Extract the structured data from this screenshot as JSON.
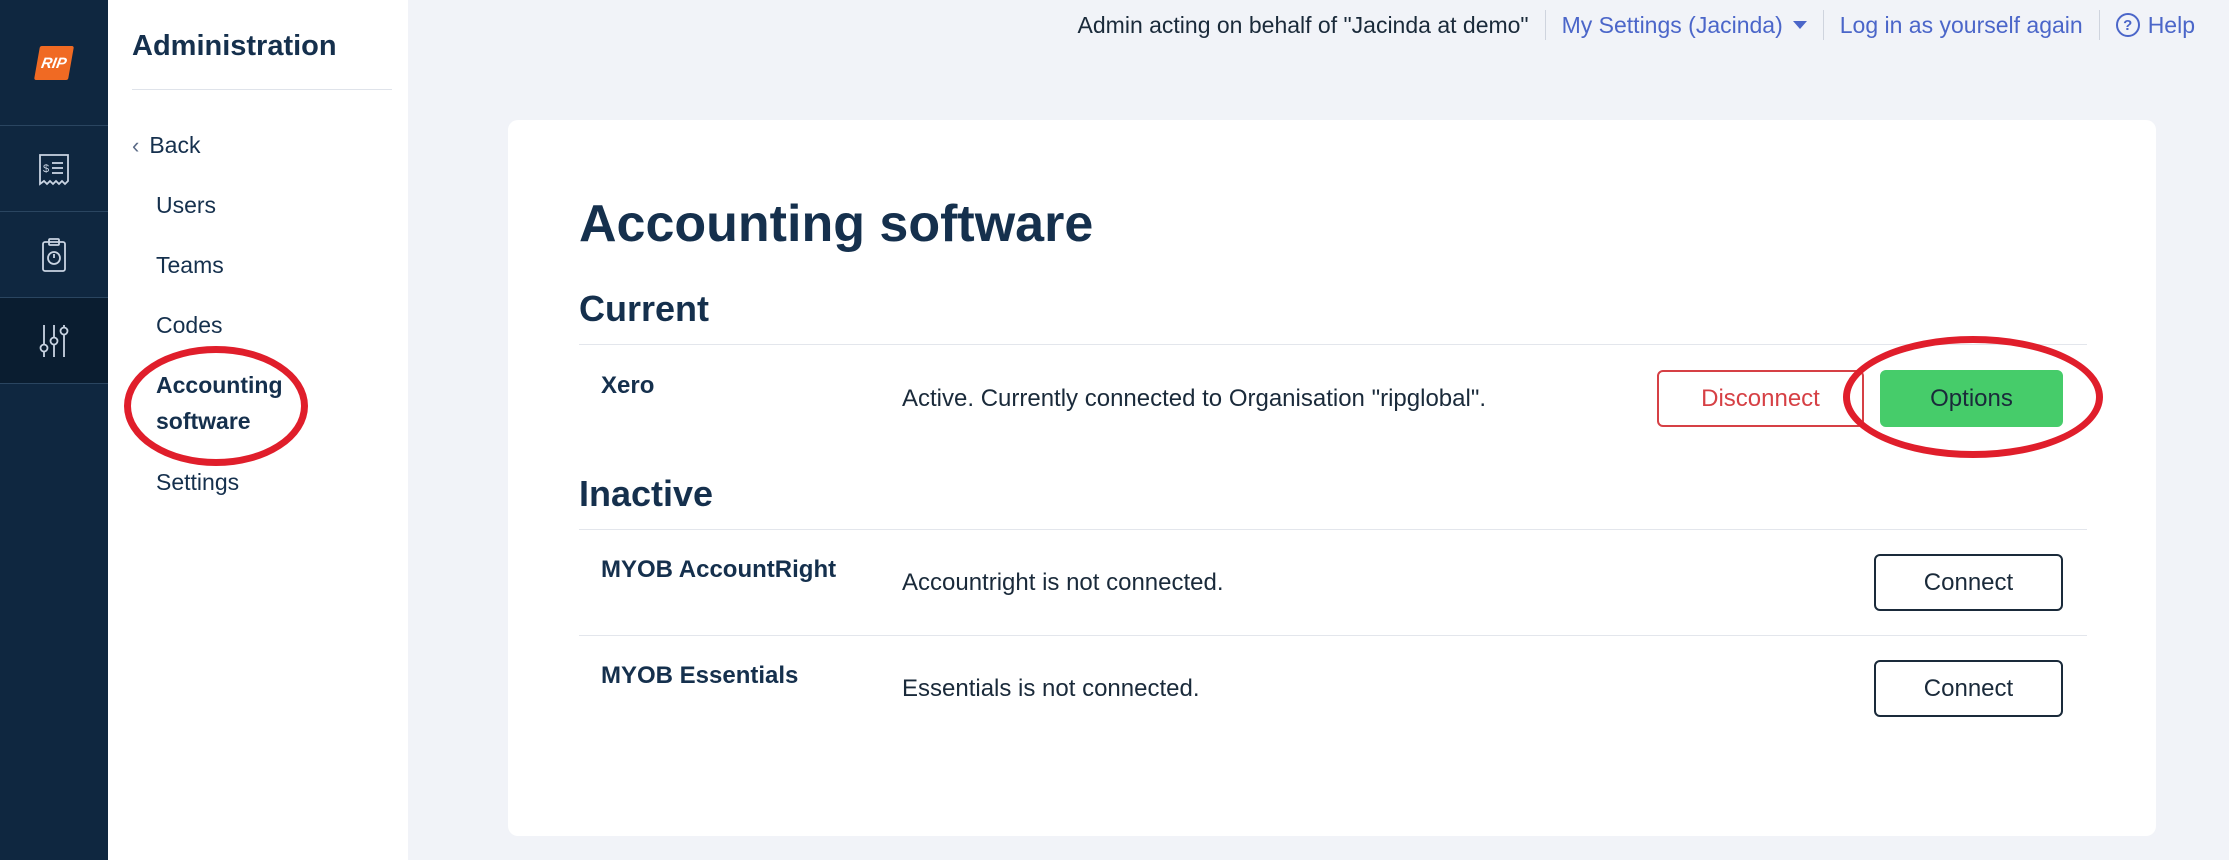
{
  "app": {
    "logo_text": "RIP"
  },
  "rail": {
    "items": [
      {
        "icon": "receipt-icon"
      },
      {
        "icon": "clipboard-timer-icon"
      },
      {
        "icon": "sliders-icon",
        "active": true
      }
    ]
  },
  "sidebar": {
    "title": "Administration",
    "back_label": "Back",
    "items": [
      {
        "label": "Users"
      },
      {
        "label": "Teams"
      },
      {
        "label": "Codes"
      },
      {
        "label": "Accounting software",
        "active": true
      },
      {
        "label": "Settings"
      }
    ]
  },
  "topbar": {
    "acting_text": "Admin acting on behalf of \"Jacinda at demo\"",
    "my_settings_label": "My Settings (Jacinda)",
    "login_again_label": "Log in as yourself again",
    "help_label": "Help",
    "help_glyph": "?"
  },
  "main": {
    "page_title": "Accounting software",
    "current_heading": "Current",
    "inactive_heading": "Inactive",
    "current": [
      {
        "name": "Xero",
        "status": "Active. Currently connected to Organisation \"ripglobal\".",
        "disconnect_label": "Disconnect",
        "options_label": "Options"
      }
    ],
    "inactive": [
      {
        "name": "MYOB AccountRight",
        "status": "Accountright is not connected.",
        "connect_label": "Connect"
      },
      {
        "name": "MYOB Essentials",
        "status": "Essentials is not connected.",
        "connect_label": "Connect"
      }
    ]
  },
  "colors": {
    "rail_bg": "#0f2740",
    "accent_link": "#4b66c9",
    "options_green": "#46cc6a",
    "disconnect_red": "#d64045",
    "annotation_red": "#e01e2b"
  }
}
